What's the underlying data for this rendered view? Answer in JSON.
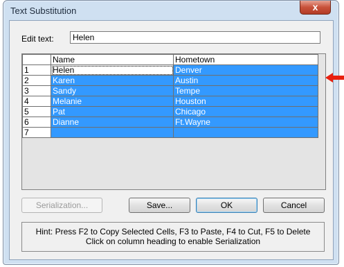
{
  "window": {
    "title": "Text Substitution",
    "close_glyph": "x"
  },
  "edit": {
    "label": "Edit text:",
    "value": "Helen"
  },
  "grid": {
    "headers": [
      "Name",
      "Hometown"
    ],
    "rows": [
      {
        "num": "1",
        "name": "Helen",
        "hometown": "Denver"
      },
      {
        "num": "2",
        "name": "Karen",
        "hometown": "Austin"
      },
      {
        "num": "3",
        "name": "Sandy",
        "hometown": "Tempe"
      },
      {
        "num": "4",
        "name": "Melanie",
        "hometown": "Houston"
      },
      {
        "num": "5",
        "name": "Pat",
        "hometown": "Chicago"
      },
      {
        "num": "6",
        "name": "Dianne",
        "hometown": "Ft.Wayne"
      },
      {
        "num": "7",
        "name": "",
        "hometown": ""
      }
    ],
    "selection_color": "#3399ff"
  },
  "buttons": {
    "serialization": "Serialization...",
    "save": "Save...",
    "ok": "OK",
    "cancel": "Cancel"
  },
  "hint": {
    "line1": "Hint: Press F2 to Copy Selected Cells, F3 to Paste, F4 to Cut, F5 to Delete",
    "line2": "Click on column heading to enable Serialization"
  },
  "annotation": {
    "icon": "red-arrow-icon",
    "color": "#e8200f"
  }
}
